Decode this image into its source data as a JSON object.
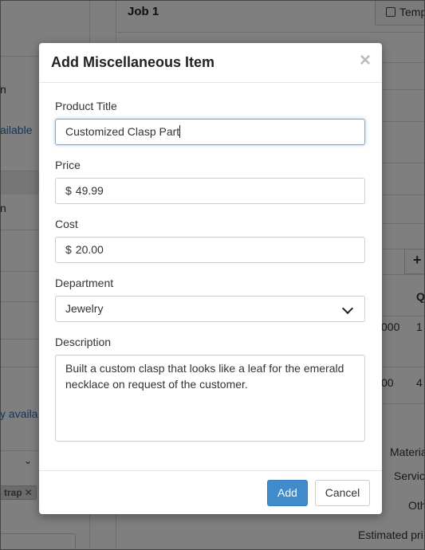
{
  "background": {
    "job_title": "Job 1",
    "template_button": "Temp",
    "left_texts": [
      "n",
      "ailable",
      "n",
      "y availa"
    ],
    "tag_label": "trap",
    "tag_close": "✕",
    "plus_label": "+",
    "right_texts": [
      "Q",
      "000",
      "1",
      "00",
      "4",
      "Materia",
      "Servic",
      "Oth",
      "Estimated pri"
    ]
  },
  "modal": {
    "title": "Add Miscellaneous Item",
    "close_glyph": "×",
    "product_title": {
      "label": "Product Title",
      "value": "Customized Clasp Part"
    },
    "price": {
      "label": "Price",
      "prefix": "$",
      "value": "49.99"
    },
    "cost": {
      "label": "Cost",
      "prefix": "$",
      "value": "20.00"
    },
    "department": {
      "label": "Department",
      "value": "Jewelry"
    },
    "description": {
      "label": "Description",
      "value": "Built a custom clasp that looks like a leaf for the emerald necklace on request of the customer."
    },
    "add_button": "Add",
    "cancel_button": "Cancel"
  }
}
